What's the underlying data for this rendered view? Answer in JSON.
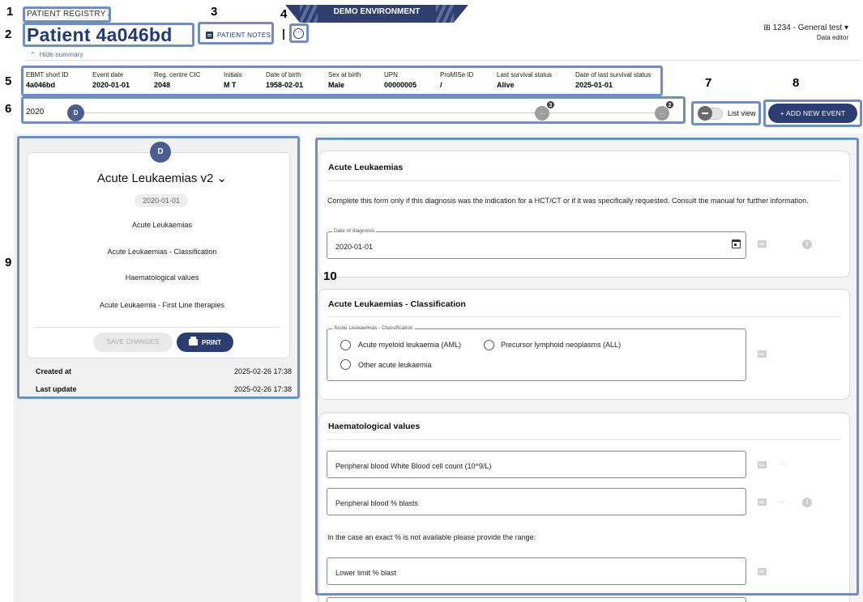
{
  "annotations": [
    "1",
    "2",
    "3",
    "4",
    "5",
    "6",
    "7",
    "8",
    "9",
    "10"
  ],
  "banner": "DEMO ENVIRONMENT",
  "breadcrumb": "PATIENT REGISTRY  /",
  "patient_title": "Patient 4a046bd",
  "notes_button": "PATIENT NOTES",
  "more_symbol": "⋯",
  "org": {
    "name": "1234 - General test",
    "role": "Data editor"
  },
  "hide_summary": "Hide summary",
  "summary": [
    {
      "label": "EBMT short ID",
      "value": "4a046bd"
    },
    {
      "label": "Event date",
      "value": "2020-01-01"
    },
    {
      "label": "Reg. centre CIC",
      "value": "2048"
    },
    {
      "label": "Initials",
      "value": "M T"
    },
    {
      "label": "Date of birth",
      "value": "1958-02-01"
    },
    {
      "label": "Sex at birth",
      "value": "Male"
    },
    {
      "label": "UPN",
      "value": "00000005"
    },
    {
      "label": "ProMISe ID",
      "value": "/"
    },
    {
      "label": "Last survival status",
      "value": "Alive"
    },
    {
      "label": "Date of last survival status",
      "value": "2025-01-01"
    }
  ],
  "timeline": {
    "year": "2020",
    "event_letter": "D",
    "group1_count": "3",
    "group2_count": "2",
    "dots_symbol": "..."
  },
  "toggle": {
    "label": "List view"
  },
  "add_event": "+ ADD NEW EVENT",
  "left_card": {
    "letter": "D",
    "title": "Acute Leukaemias v2 ⌄",
    "date": "2020-01-01",
    "sections": [
      "Acute Leukaemias",
      "Acute Leukaemias - Classification",
      "Haematological values",
      "Acute Leukaemia - First Line therapies"
    ],
    "save_label": "SAVE CHANGES",
    "print_label": "PRINT",
    "created_label": "Created at",
    "created_value": "2025-02-26 17:38",
    "updated_label": "Last update",
    "updated_value": "2025-02-26 17:38"
  },
  "form": {
    "card1": {
      "title": "Acute Leukaemias",
      "description": "Complete this form only if this diagnosis was the indication for a HCT/CT or if it was specifically requested. Consult the manual for further information.",
      "date_label": "Date of diagnosis",
      "date_value": "2020-01-01"
    },
    "card2": {
      "title": "Acute Leukaemias - Classification",
      "group_label": "Acute Leukaemias - Classification",
      "options": [
        "Acute myeloid leukaemia (AML)",
        "Precursor lymphoid neoplasms (ALL)",
        "Other acute leukaemia"
      ]
    },
    "card3": {
      "title": "Haematological values",
      "field1": "Peripheral blood White Blood cell count (10^9/L)",
      "field2": "Peripheral blood % blasts",
      "range_note": "In the case an exact % is not available please provide the range:",
      "field3": "Lower limit % blast"
    },
    "info_symbol": "i",
    "dots_symbol": "···"
  },
  "colors": {
    "primary": "#2c3d72",
    "annotation_box": "#6f8fc4",
    "title": "#233a78"
  }
}
